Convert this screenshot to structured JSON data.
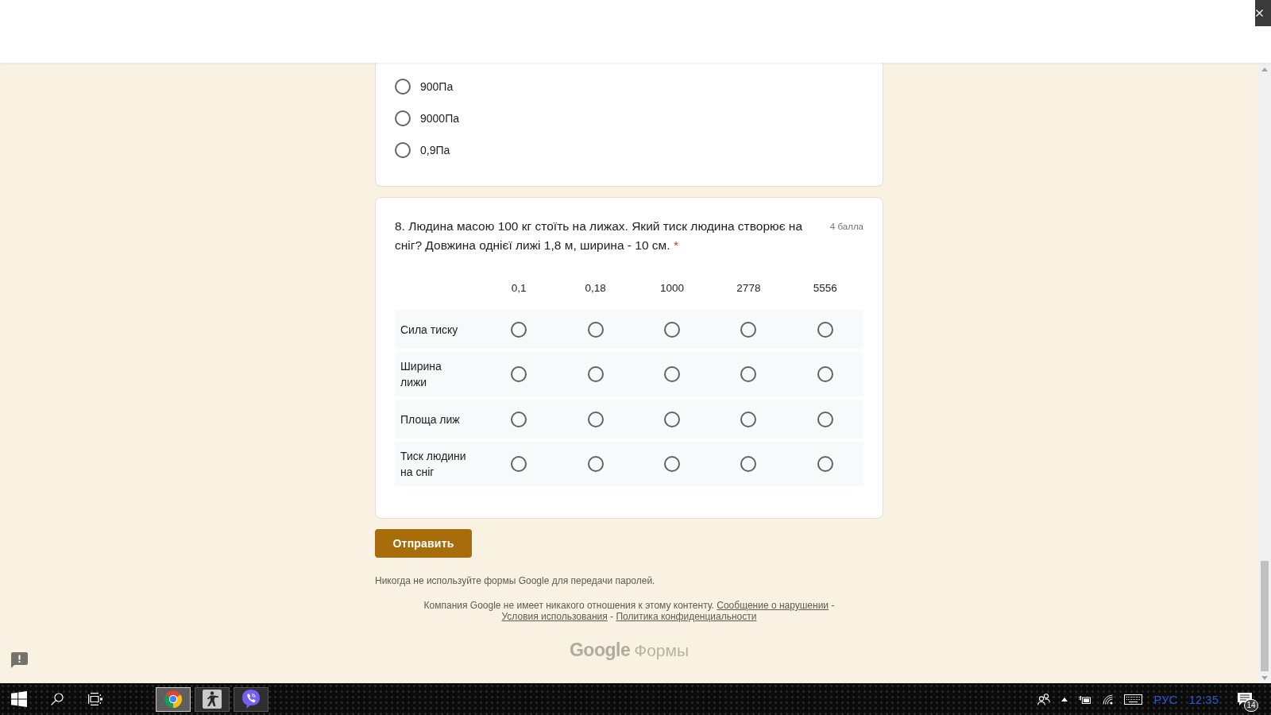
{
  "previous_question": {
    "options": [
      {
        "label": "900Па",
        "selected": false
      },
      {
        "label": "9000Па",
        "selected": false
      },
      {
        "label": "0,9Па",
        "selected": false
      }
    ]
  },
  "question": {
    "title": "8. Людина масою 100 кг стоїть на лижах. Який тиск людина створює на сніг? Довжина однієї лижі 1,8 м, ширина - 10 см.",
    "required_mark": "*",
    "points": "4 балла",
    "columns": [
      "0,1",
      "0,18",
      "1000",
      "2778",
      "5556"
    ],
    "rows": [
      {
        "label": "Сила тиску",
        "choices": [
          {
            "selected": false
          },
          {
            "selected": false
          },
          {
            "selected": false
          },
          {
            "selected": false
          },
          {
            "selected": false
          }
        ]
      },
      {
        "label": "Ширина лижи",
        "choices": [
          {
            "selected": false
          },
          {
            "selected": false
          },
          {
            "selected": false
          },
          {
            "selected": false
          },
          {
            "selected": false
          }
        ]
      },
      {
        "label": "Площа лиж",
        "choices": [
          {
            "selected": false
          },
          {
            "selected": false
          },
          {
            "selected": false
          },
          {
            "selected": false
          },
          {
            "selected": false
          }
        ]
      },
      {
        "label": "Тиск людини на сніг",
        "choices": [
          {
            "selected": false
          },
          {
            "selected": false
          },
          {
            "selected": false
          },
          {
            "selected": false
          },
          {
            "selected": false
          }
        ]
      }
    ]
  },
  "submit_button": {
    "label": "Отправить"
  },
  "footer": {
    "password_warning": "Никогда не используйте формы Google для передачи паролей.",
    "disclaimer": [
      {
        "kind": "text",
        "text": "Компания Google не имеет никакого отношения к этому контенту."
      },
      {
        "kind": "link",
        "text": "Сообщение о нарушении"
      },
      {
        "kind": "text",
        "text": "-"
      },
      {
        "kind": "link",
        "text": "Условия использования"
      },
      {
        "kind": "text",
        "text": "-"
      },
      {
        "kind": "link",
        "text": "Политика конфиденциальности"
      }
    ],
    "logo": {
      "brand": "Google",
      "product": "Формы"
    }
  },
  "taskbar": {
    "apps": [
      {
        "kind": "chrome",
        "selected": true
      },
      {
        "kind": "game",
        "selected": false
      },
      {
        "kind": "viber",
        "selected": false
      }
    ],
    "language": "РУС",
    "time": "12:35",
    "notification_count": "14"
  }
}
